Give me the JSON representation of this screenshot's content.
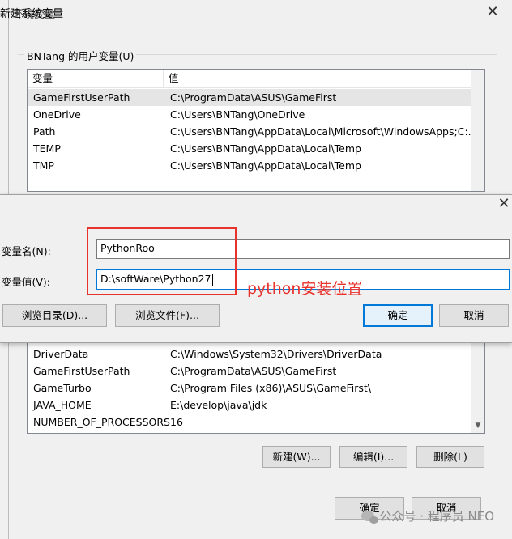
{
  "bg_dialog": {
    "title": "环境变量",
    "close_label": "✕",
    "user_group_label": "BNTang 的用户变量(U)",
    "user_table": {
      "headers": [
        "变量",
        "值"
      ],
      "rows": [
        {
          "var": "GameFirstUserPath",
          "val": "C:\\ProgramData\\ASUS\\GameFirst"
        },
        {
          "var": "OneDrive",
          "val": "C:\\Users\\BNTang\\OneDrive"
        },
        {
          "var": "Path",
          "val": "C:\\Users\\BNTang\\AppData\\Local\\Microsoft\\WindowsApps;C:..."
        },
        {
          "var": "TEMP",
          "val": "C:\\Users\\BNTang\\AppData\\Local\\Temp"
        },
        {
          "var": "TMP",
          "val": "C:\\Users\\BNTang\\AppData\\Local\\Temp"
        }
      ]
    },
    "system_table": {
      "rows": [
        {
          "var": "DriverData",
          "val": "C:\\Windows\\System32\\Drivers\\DriverData"
        },
        {
          "var": "GameFirstUserPath",
          "val": "C:\\ProgramData\\ASUS\\GameFirst"
        },
        {
          "var": "GameTurbo",
          "val": "C:\\Program Files (x86)\\ASUS\\GameFirst\\"
        },
        {
          "var": "JAVA_HOME",
          "val": "E:\\develop\\java\\jdk"
        },
        {
          "var": "NUMBER_OF_PROCESSORS",
          "val": "16"
        }
      ]
    },
    "buttons": {
      "new": "新建(W)...",
      "edit": "编辑(I)...",
      "delete": "删除(L)",
      "ok": "确定",
      "cancel": "取消"
    }
  },
  "new_dialog": {
    "title": "新建系统变量",
    "close_label": "✕",
    "name_label": "变量名(N):",
    "value_label": "变量值(V):",
    "name_value": "PythonRoo",
    "value_value": "D:\\softWare\\Python27",
    "buttons": {
      "browse_dir": "浏览目录(D)...",
      "browse_file": "浏览文件(F)...",
      "ok": "确定",
      "cancel": "取消"
    }
  },
  "annotation": {
    "text": "python安装位置",
    "color": "#e8322c"
  },
  "watermark": {
    "text": "公众号 · 程序员 NEO"
  },
  "colors": {
    "accent": "#0078d7",
    "annotation": "#e8322c"
  }
}
